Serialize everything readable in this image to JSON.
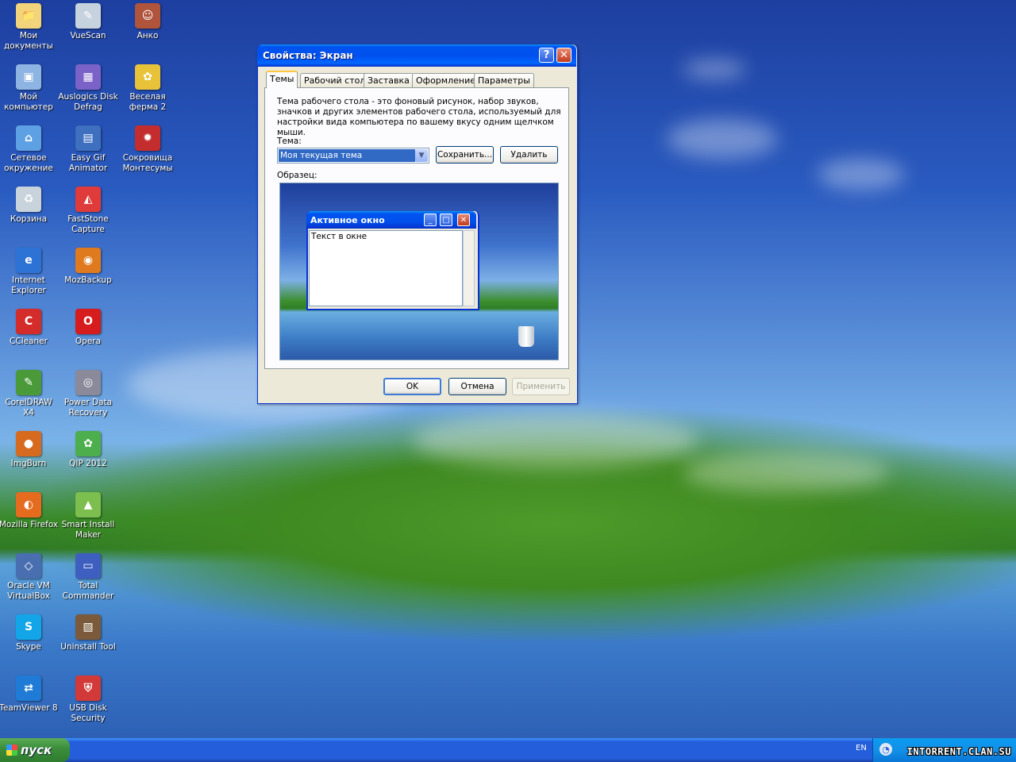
{
  "desktop": {
    "icons": [
      {
        "label": "Мои документы",
        "icon": "my-documents-icon",
        "color": "#f2d47a",
        "glyph": "📁"
      },
      {
        "label": "VueScan",
        "icon": "vuescan-icon",
        "color": "#c7d2df",
        "glyph": "✎"
      },
      {
        "label": "Анко",
        "icon": "anko-icon",
        "color": "#b0543c",
        "glyph": "☺"
      },
      {
        "label": "Мой компьютер",
        "icon": "my-computer-icon",
        "color": "#8db4e3",
        "glyph": "▣"
      },
      {
        "label": "Auslogics Disk Defrag",
        "icon": "defrag-icon",
        "color": "#7b62c8",
        "glyph": "▦"
      },
      {
        "label": "Веселая ферма 2",
        "icon": "farm-game-icon",
        "color": "#e8c33a",
        "glyph": "✿"
      },
      {
        "label": "Сетевое окружение",
        "icon": "network-icon",
        "color": "#5ea0e4",
        "glyph": "⌂"
      },
      {
        "label": "Easy Gif Animator",
        "icon": "gif-animator-icon",
        "color": "#3f6fbf",
        "glyph": "▤"
      },
      {
        "label": "Сокровища Монтесумы",
        "icon": "montezuma-icon",
        "color": "#c42d2d",
        "glyph": "✹"
      },
      {
        "label": "Корзина",
        "icon": "recycle-bin-icon",
        "color": "#c9d3dc",
        "glyph": "♻"
      },
      {
        "label": "FastStone Capture",
        "icon": "faststone-icon",
        "color": "#e03b3b",
        "glyph": "◭"
      },
      {
        "label": "Internet Explorer",
        "icon": "internet-explorer-icon",
        "color": "#2d73d6",
        "glyph": "e"
      },
      {
        "label": "MozBackup",
        "icon": "mozbackup-icon",
        "color": "#e07a1e",
        "glyph": "◉"
      },
      {
        "label": "CCleaner",
        "icon": "ccleaner-icon",
        "color": "#d42b2b",
        "glyph": "C"
      },
      {
        "label": "Opera",
        "icon": "opera-icon",
        "color": "#d61c1c",
        "glyph": "O"
      },
      {
        "label": "CorelDRAW X4",
        "icon": "coreldraw-icon",
        "color": "#4a9a3a",
        "glyph": "✎"
      },
      {
        "label": "Power Data Recovery",
        "icon": "data-recovery-icon",
        "color": "#8a8a9a",
        "glyph": "◎"
      },
      {
        "label": "ImgBurn",
        "icon": "imgburn-icon",
        "color": "#d66a1f",
        "glyph": "●"
      },
      {
        "label": "QIP 2012",
        "icon": "qip-icon",
        "color": "#4cae4c",
        "glyph": "✿"
      },
      {
        "label": "Mozilla Firefox",
        "icon": "firefox-icon",
        "color": "#e56b1f",
        "glyph": "◐"
      },
      {
        "label": "Smart Install Maker",
        "icon": "smart-install-icon",
        "color": "#7cbf4f",
        "glyph": "▲"
      },
      {
        "label": "Oracle VM VirtualBox",
        "icon": "virtualbox-icon",
        "color": "#4a6fb0",
        "glyph": "◇"
      },
      {
        "label": "Total Commander",
        "icon": "total-commander-icon",
        "color": "#3e5fbf",
        "glyph": "▭"
      },
      {
        "label": "Skype",
        "icon": "skype-icon",
        "color": "#12a5e8",
        "glyph": "S"
      },
      {
        "label": "Uninstall Tool",
        "icon": "uninstall-tool-icon",
        "color": "#7a5a3a",
        "glyph": "▧"
      },
      {
        "label": "TeamViewer 8",
        "icon": "teamviewer-icon",
        "color": "#1f7bd6",
        "glyph": "⇄"
      },
      {
        "label": "USB Disk Security",
        "icon": "usb-security-icon",
        "color": "#d23a3a",
        "glyph": "⛨"
      }
    ]
  },
  "dialog": {
    "title": "Свойства: Экран",
    "tabs": [
      "Темы",
      "Рабочий стол",
      "Заставка",
      "Оформление",
      "Параметры"
    ],
    "description": "Тема рабочего стола - это фоновый рисунок, набор звуков, значков и других элементов рабочего стола, используемый для настройки вида компьютера по вашему вкусу одним щелчком мыши.",
    "theme_label": "Тема:",
    "theme_value": "Моя текущая тема",
    "save_label": "Сохранить...",
    "delete_label": "Удалить",
    "sample_label": "Образец:",
    "preview": {
      "window_title": "Активное окно",
      "window_text": "Текст в окне"
    },
    "ok_label": "OK",
    "cancel_label": "Отмена",
    "apply_label": "Применить"
  },
  "taskbar": {
    "start_label": "пуск",
    "language": "EN",
    "watermark": "INTORRENT.CLAN.SU"
  },
  "colors": {
    "title_blue": "#0053ee",
    "start_green": "#3c8f3c",
    "taskbar_blue": "#245edb"
  }
}
